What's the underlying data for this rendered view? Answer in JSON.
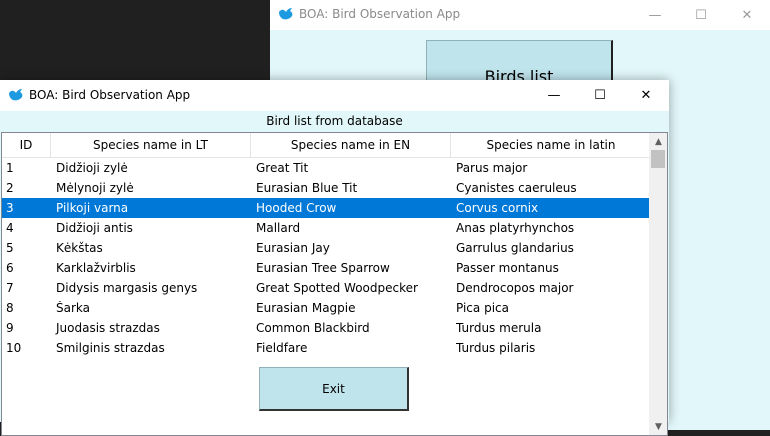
{
  "background_window": {
    "title": "BOA: Bird Observation App",
    "minimize": "—",
    "maximize": "☐",
    "close": "✕",
    "birds_list_button": "Birds list"
  },
  "window": {
    "title": "BOA: Bird Observation App",
    "minimize": "—",
    "maximize": "☐",
    "close": "✕",
    "heading": "Bird list from database",
    "exit_button": "Exit",
    "app_icon": "bird-icon",
    "accent_color": "#0078d7",
    "background_color": "#e1f7fa"
  },
  "table": {
    "columns": [
      "ID",
      "Species name in LT",
      "Species name in EN",
      "Species name in latin"
    ],
    "selected_row": 3,
    "rows": [
      {
        "id": "1",
        "lt": "Didžioji zylė",
        "en": "Great Tit",
        "la": "Parus major"
      },
      {
        "id": "2",
        "lt": "Mėlynoji zylė",
        "en": "Eurasian Blue Tit",
        "la": "Cyanistes caeruleus"
      },
      {
        "id": "3",
        "lt": "Pilkoji varna",
        "en": "Hooded Crow",
        "la": "Corvus cornix"
      },
      {
        "id": "4",
        "lt": "Didžioji antis",
        "en": "Mallard",
        "la": "Anas platyrhynchos"
      },
      {
        "id": "5",
        "lt": "Kėkštas",
        "en": "Eurasian Jay",
        "la": "Garrulus glandarius"
      },
      {
        "id": "6",
        "lt": "Karklažvirblis",
        "en": "Eurasian Tree Sparrow",
        "la": "Passer montanus"
      },
      {
        "id": "7",
        "lt": "Didysis margasis genys",
        "en": "Great Spotted Woodpecker",
        "la": "Dendrocopos major"
      },
      {
        "id": "8",
        "lt": "Šarka",
        "en": "Eurasian Magpie",
        "la": "Pica pica"
      },
      {
        "id": "9",
        "lt": "Juodasis strazdas",
        "en": "Common Blackbird",
        "la": "Turdus merula"
      },
      {
        "id": "10",
        "lt": "Smilginis strazdas",
        "en": "Fieldfare",
        "la": "Turdus pilaris"
      }
    ]
  },
  "scrollbar": {
    "up_arrow": "▲",
    "down_arrow": "▼"
  }
}
